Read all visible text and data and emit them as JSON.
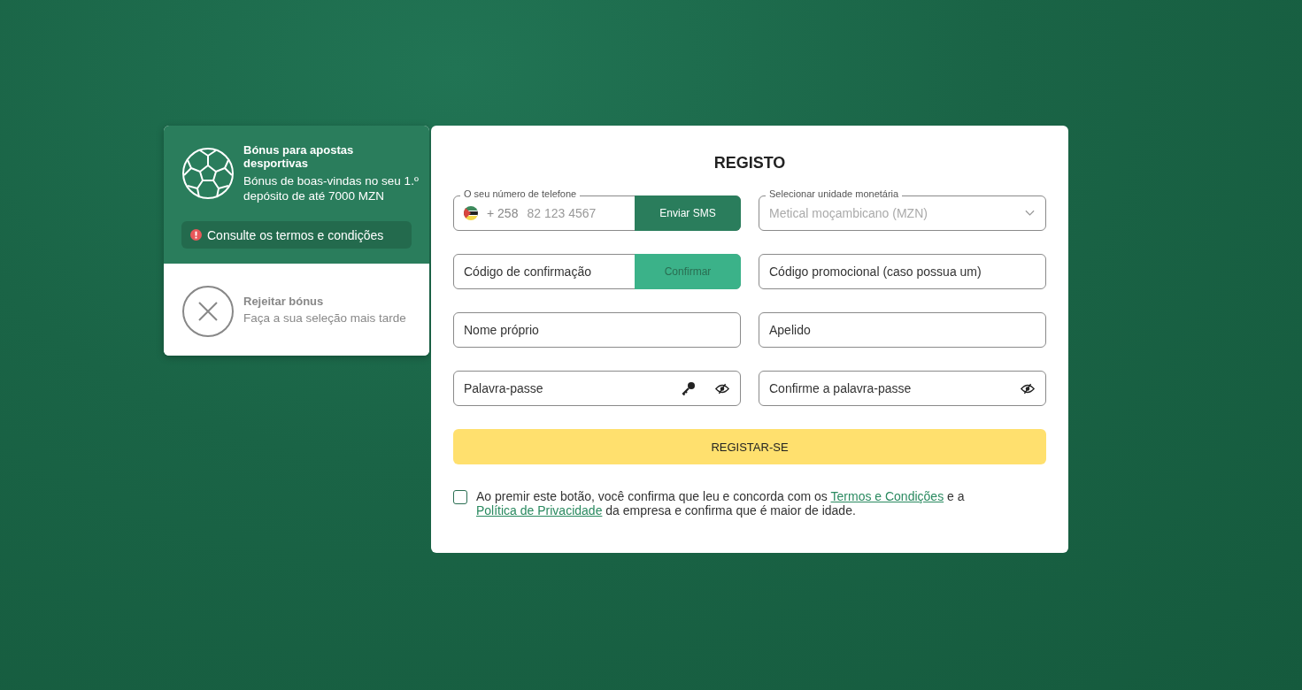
{
  "bonus_options": [
    {
      "kind": "sports",
      "selected": true,
      "title": "Bónus para apostas desportivas",
      "description": "Bónus de boas-vindas no seu 1.º depósito de até 7000 MZN",
      "note": "Consulte os termos e condições"
    },
    {
      "kind": "reject",
      "selected": false,
      "title": "Rejeitar bónus",
      "description": "Faça a sua seleção mais tarde"
    }
  ],
  "form": {
    "title": "REGISTO",
    "phone": {
      "label": "O seu número de telefone",
      "country_code": "+ 258",
      "placeholder": "82 123 4567",
      "button": "Enviar SMS"
    },
    "currency": {
      "label": "Selecionar unidade monetária",
      "value": "Metical moçambicano (MZN)",
      "disabled": true
    },
    "confirmation_code": {
      "placeholder": "Código de confirmação",
      "button": "Confirmar",
      "button_disabled": true
    },
    "promo_code": {
      "placeholder": "Código promocional (caso possua um)"
    },
    "first_name": {
      "placeholder": "Nome próprio"
    },
    "last_name": {
      "placeholder": "Apelido"
    },
    "password": {
      "placeholder": "Palavra-passe"
    },
    "confirm_password": {
      "placeholder": "Confirme a palavra-passe"
    },
    "submit": "REGISTAR-SE",
    "consent": {
      "checked": false,
      "text_before": "Ao premir este botão, você confirma que leu e concorda com os",
      "link_terms": "Termos e Condições",
      "text_middle": "e a",
      "link_privacy": "Política de Privacidade",
      "text_after": "da empresa e confirma que é maior de idade."
    }
  }
}
